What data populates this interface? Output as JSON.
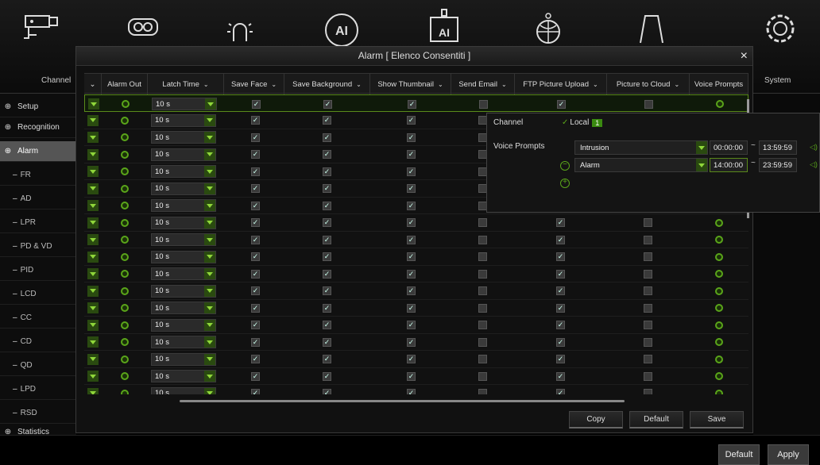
{
  "top_nav": [
    {
      "label": "Channel",
      "icon": "camera-icon"
    },
    {
      "label": "",
      "icon": "recording-icon"
    },
    {
      "label": "",
      "icon": "motion-alarm-icon"
    },
    {
      "label": "",
      "icon": "ai-icon"
    },
    {
      "label": "",
      "icon": "ai-device-icon"
    },
    {
      "label": "",
      "icon": "network-icon"
    },
    {
      "label": "",
      "icon": "storage-icon"
    },
    {
      "label": "System",
      "icon": "gear-icon"
    }
  ],
  "sidebar": {
    "items": [
      {
        "label": "Setup",
        "sub": false,
        "active": false
      },
      {
        "label": "Recognition",
        "sub": false,
        "active": false
      },
      {
        "label": "Alarm",
        "sub": false,
        "active": true
      },
      {
        "label": "FR",
        "sub": true
      },
      {
        "label": "AD",
        "sub": true
      },
      {
        "label": "LPR",
        "sub": true
      },
      {
        "label": "PD & VD",
        "sub": true
      },
      {
        "label": "PID",
        "sub": true
      },
      {
        "label": "LCD",
        "sub": true
      },
      {
        "label": "CC",
        "sub": true
      },
      {
        "label": "CD",
        "sub": true
      },
      {
        "label": "QD",
        "sub": true
      },
      {
        "label": "LPD",
        "sub": true
      },
      {
        "label": "RSD",
        "sub": true
      },
      {
        "label": "Statistics",
        "sub": false,
        "active": false
      }
    ]
  },
  "modal": {
    "title": "Alarm [ Elenco Consentiti ]",
    "close": "×",
    "columns": [
      {
        "label": "",
        "chevron": "⌄"
      },
      {
        "label": "Alarm Out",
        "chevron": ""
      },
      {
        "label": "Latch Time",
        "chevron": "⌄"
      },
      {
        "label": "Save Face",
        "chevron": "⌄"
      },
      {
        "label": "Save Background",
        "chevron": "⌄"
      },
      {
        "label": "Show Thumbnail",
        "chevron": "⌄"
      },
      {
        "label": "Send Email",
        "chevron": "⌄"
      },
      {
        "label": "FTP Picture Upload",
        "chevron": "⌄"
      },
      {
        "label": "Picture to Cloud",
        "chevron": "⌄"
      },
      {
        "label": "Voice Prompts",
        "chevron": ""
      }
    ],
    "latch_value": "10 s",
    "row_count": 18,
    "buttons": {
      "copy": "Copy",
      "default": "Default",
      "save": "Save"
    }
  },
  "popup": {
    "channel_label": "Channel",
    "channel_value": "Local",
    "channel_badge": "1",
    "voice_label": "Voice Prompts",
    "prompts": [
      {
        "name": "Intrusion",
        "start": "00:00:00",
        "end": "13:59:59"
      },
      {
        "name": "Alarm",
        "start": "14:00:00",
        "end": "23:59:59"
      }
    ],
    "tilde": "~"
  },
  "bottom": {
    "default": "Default",
    "apply": "Apply"
  },
  "colors": {
    "accent": "#5aa51a",
    "dropdown": "#2a4a10"
  }
}
